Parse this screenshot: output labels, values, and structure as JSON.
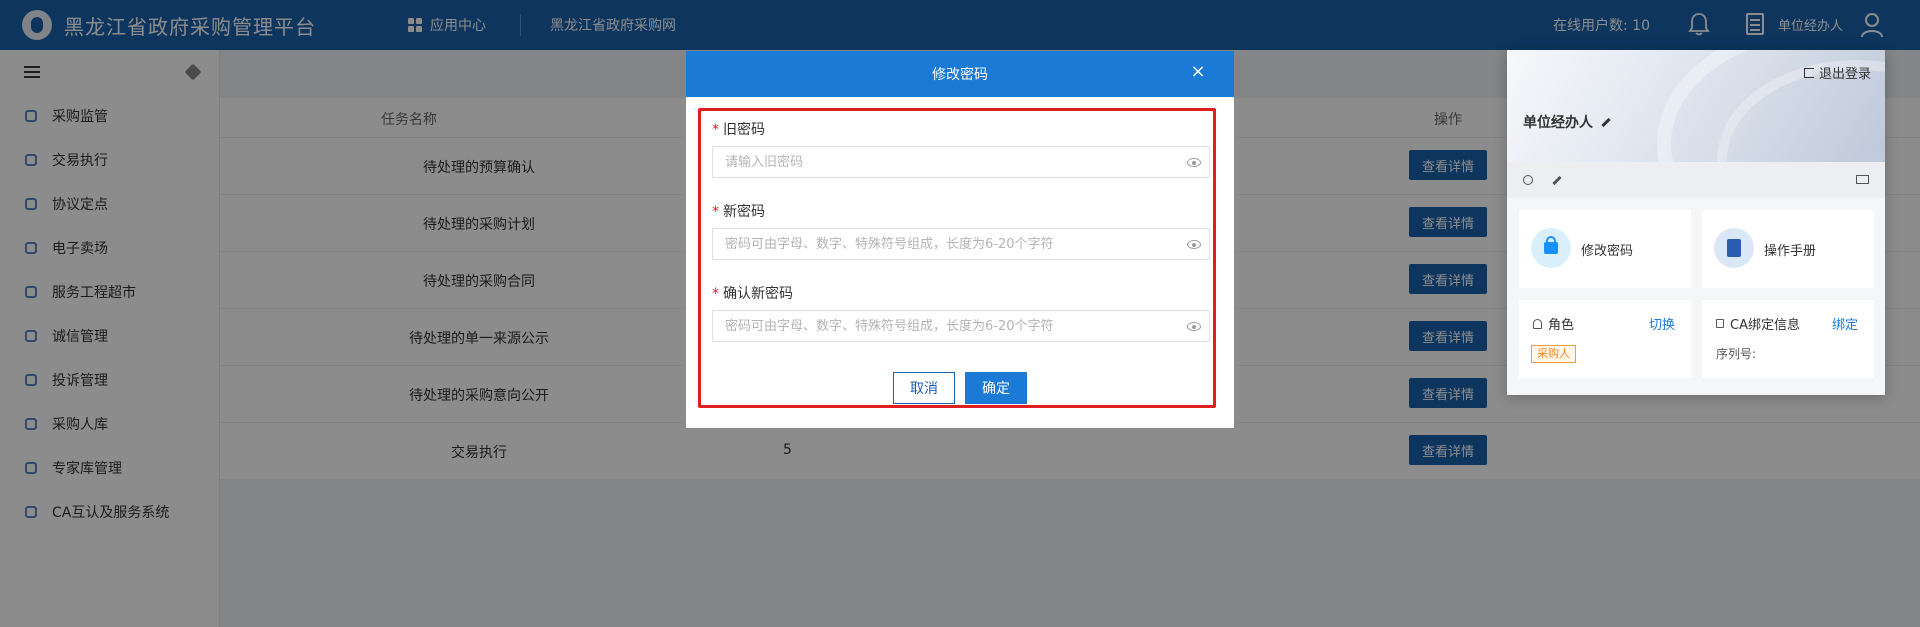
{
  "header": {
    "title": "黑龙江省政府采购管理平台",
    "nav_apps": "应用中心",
    "nav_web": "黑龙江省政府采购网",
    "online_users": "在线用户数: 10",
    "user": "单位经办人"
  },
  "sidebar": {
    "items": [
      {
        "label": "采购监管",
        "icon": "shield-icon"
      },
      {
        "label": "交易执行",
        "icon": "clipboard-icon"
      },
      {
        "label": "协议定点",
        "icon": "store-icon"
      },
      {
        "label": "电子卖场",
        "icon": "shop-icon"
      },
      {
        "label": "服务工程超市",
        "icon": "market-icon"
      },
      {
        "label": "诚信管理",
        "icon": "list-icon"
      },
      {
        "label": "投诉管理",
        "icon": "complaint-icon"
      },
      {
        "label": "采购人库",
        "icon": "bag-icon"
      },
      {
        "label": "专家库管理",
        "icon": "gear-icon"
      },
      {
        "label": "CA互认及服务系统",
        "icon": "person-icon"
      }
    ]
  },
  "table": {
    "headers": {
      "name": "任务名称",
      "action": "操作"
    },
    "detail_label": "查看详情",
    "rows": [
      {
        "name": "待处理的预算确认",
        "count": ""
      },
      {
        "name": "待处理的采购计划",
        "count": ""
      },
      {
        "name": "待处理的采购合同",
        "count": ""
      },
      {
        "name": "待处理的单一来源公示",
        "count": ""
      },
      {
        "name": "待处理的采购意向公开",
        "count": ""
      },
      {
        "name": "交易执行",
        "count": "5"
      }
    ]
  },
  "modal": {
    "title": "修改密码",
    "close": "×",
    "old_label": "旧密码",
    "old_placeholder": "请输入旧密码",
    "new_label": "新密码",
    "new_placeholder": "密码可由字母、数字、特殊符号组成，长度为6-20个字符",
    "confirm_label": "确认新密码",
    "confirm_placeholder": "密码可由字母、数字、特殊符号组成，长度为6-20个字符",
    "required_mark": "*",
    "cancel": "取消",
    "ok": "确定"
  },
  "user_panel": {
    "logout": "退出登录",
    "name": "单位经办人",
    "change_password": "修改密码",
    "manual": "操作手册",
    "role_label": "角色",
    "switch": "切换",
    "role_tag": "采购人",
    "ca_label": "CA绑定信息",
    "bind": "绑定",
    "serial": "序列号:"
  },
  "colors": {
    "primary": "#1a62ac",
    "modal_header": "#1a7ad6",
    "highlight_border": "#e02020",
    "role_tag": "#f08a24"
  }
}
